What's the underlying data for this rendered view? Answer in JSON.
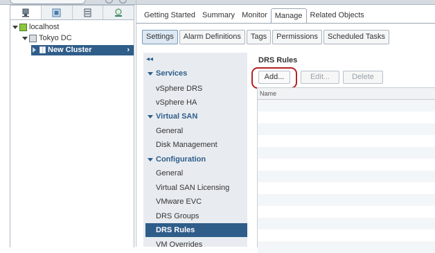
{
  "navigator": {
    "tabs": [
      "hosts-clusters-tab",
      "vms-templates-tab",
      "storage-tab",
      "networking-tab"
    ],
    "tree": [
      {
        "label": "localhost",
        "icon": "vcenter-icon",
        "expanded": true
      },
      {
        "label": "Tokyo DC",
        "icon": "datacenter-icon",
        "expanded": true
      },
      {
        "label": "New Cluster",
        "icon": "cluster-icon",
        "selected": true
      }
    ]
  },
  "main": {
    "tabs": [
      "Getting Started",
      "Summary",
      "Monitor",
      "Manage",
      "Related Objects"
    ],
    "active_tab": "Manage",
    "subtabs": [
      "Settings",
      "Alarm Definitions",
      "Tags",
      "Permissions",
      "Scheduled Tasks"
    ],
    "active_subtab": "Settings"
  },
  "settings_nav": {
    "collapse_glyph": "◂◂",
    "sections": [
      {
        "title": "Services",
        "items": [
          "vSphere DRS",
          "vSphere HA"
        ]
      },
      {
        "title": "Virtual SAN",
        "items": [
          "General",
          "Disk Management"
        ]
      },
      {
        "title": "Configuration",
        "items": [
          "General",
          "Virtual SAN Licensing",
          "VMware EVC",
          "DRS Groups",
          "DRS Rules",
          "VM Overrides"
        ]
      }
    ],
    "selected_item": "DRS Rules"
  },
  "drs_rules": {
    "title": "DRS Rules",
    "buttons": {
      "add": "Add...",
      "edit": "Edit...",
      "delete": "Delete"
    },
    "columns": [
      "Name"
    ]
  },
  "colors": {
    "accent": "#2f5d8a",
    "highlight_ring": "#b22222"
  }
}
